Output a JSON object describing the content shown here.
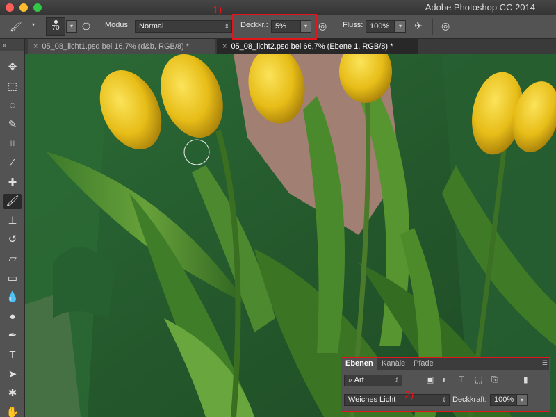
{
  "window": {
    "title": "Adobe Photoshop CC 2014"
  },
  "options_bar": {
    "brush_size": "70",
    "mode_label": "Modus:",
    "mode_value": "Normal",
    "opacity_label": "Deckkr.:",
    "opacity_value": "5%",
    "flow_label": "Fluss:",
    "flow_value": "100%"
  },
  "tabs": [
    {
      "label": "05_08_licht1.psd bei 16,7% (d&b, RGB/8) *",
      "active": false
    },
    {
      "label": "05_08_licht2.psd bei 66,7% (Ebene 1, RGB/8) *",
      "active": true
    }
  ],
  "tools": [
    {
      "name": "move-tool",
      "glyph": "✥"
    },
    {
      "name": "marquee-tool",
      "glyph": "⬚"
    },
    {
      "name": "lasso-tool",
      "glyph": "◌"
    },
    {
      "name": "quick-selection-tool",
      "glyph": "✎"
    },
    {
      "name": "crop-tool",
      "glyph": "⌗"
    },
    {
      "name": "eyedropper-tool",
      "glyph": "⁄"
    },
    {
      "name": "healing-brush-tool",
      "glyph": "✚"
    },
    {
      "name": "brush-tool",
      "glyph": "🖌"
    },
    {
      "name": "clone-stamp-tool",
      "glyph": "⊥"
    },
    {
      "name": "history-brush-tool",
      "glyph": "↺"
    },
    {
      "name": "eraser-tool",
      "glyph": "▱"
    },
    {
      "name": "gradient-tool",
      "glyph": "▭"
    },
    {
      "name": "blur-tool",
      "glyph": "💧"
    },
    {
      "name": "dodge-tool",
      "glyph": "●"
    },
    {
      "name": "pen-tool",
      "glyph": "✒"
    },
    {
      "name": "type-tool",
      "glyph": "T"
    },
    {
      "name": "path-selection-tool",
      "glyph": "➤"
    },
    {
      "name": "custom-shape-tool",
      "glyph": "✱"
    },
    {
      "name": "hand-tool",
      "glyph": "✋"
    }
  ],
  "annotations": {
    "one": "1)",
    "two": "2)"
  },
  "layers_panel": {
    "tabs": [
      "Ebenen",
      "Kanäle",
      "Pfade"
    ],
    "filter_value": "Art",
    "blend_mode": "Weiches Licht",
    "opacity_label": "Deckkraft:",
    "opacity_value": "100%"
  },
  "colors": {
    "highlight_red": "#e0161a",
    "ui_gray": "#535353"
  }
}
